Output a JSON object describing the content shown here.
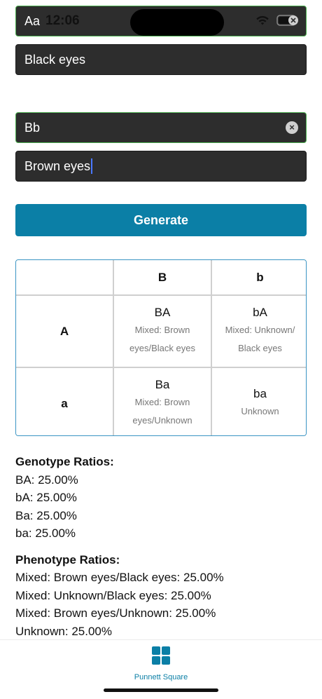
{
  "status_bar": {
    "aa": "Aa",
    "time": "12:06"
  },
  "inputs": {
    "parent1_trait": "Black eyes",
    "parent2_genotype": "Bb",
    "parent2_trait": "Brown eyes"
  },
  "generate_label": "Generate",
  "punnett": {
    "col_headers": [
      "B",
      "b"
    ],
    "rows": [
      {
        "header": "A",
        "cells": [
          {
            "genotype": "BA",
            "phenotype": "Mixed: Brown eyes/Black eyes"
          },
          {
            "genotype": "bA",
            "phenotype": "Mixed: Unknown/ Black eyes"
          }
        ]
      },
      {
        "header": "a",
        "cells": [
          {
            "genotype": "Ba",
            "phenotype": "Mixed: Brown eyes/Unknown"
          },
          {
            "genotype": "ba",
            "phenotype": "Unknown"
          }
        ]
      }
    ]
  },
  "genotype_ratios": {
    "title": "Genotype Ratios:",
    "lines": [
      "BA: 25.00%",
      "bA: 25.00%",
      "Ba: 25.00%",
      "ba: 25.00%"
    ]
  },
  "phenotype_ratios": {
    "title": "Phenotype Ratios:",
    "lines": [
      "Mixed: Brown eyes/Black eyes: 25.00%",
      "Mixed: Unknown/Black eyes: 25.00%",
      "Mixed: Brown eyes/Unknown: 25.00%",
      "Unknown: 25.00%"
    ]
  },
  "tabbar": {
    "tab_label": "Punnett Square",
    "tab_icon": "grid-icon",
    "accent": "#0b7fa6"
  }
}
